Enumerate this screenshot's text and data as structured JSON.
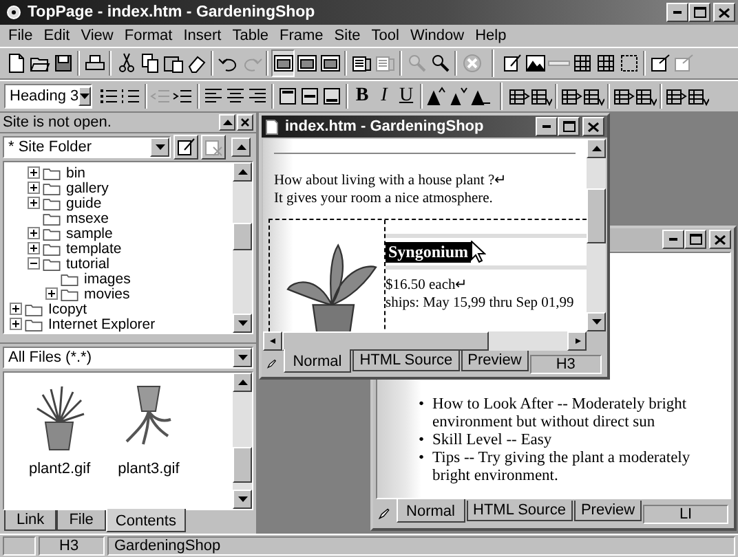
{
  "window": {
    "title": "TopPage - index.htm - GardeningShop"
  },
  "menu": [
    "File",
    "Edit",
    "View",
    "Format",
    "Insert",
    "Table",
    "Frame",
    "Site",
    "Tool",
    "Window",
    "Help"
  ],
  "toolbar_1": [
    {
      "disabled": false,
      "pressed": false
    },
    {
      "disabled": false,
      "pressed": false
    },
    {
      "disabled": false,
      "pressed": false
    },
    {
      "disabled": false,
      "pressed": false
    },
    {
      "disabled": false,
      "pressed": false
    },
    {
      "disabled": false,
      "pressed": false
    },
    {
      "disabled": false,
      "pressed": false
    },
    {
      "disabled": false,
      "pressed": false
    },
    {
      "disabled": false,
      "pressed": false
    },
    {
      "disabled": true,
      "pressed": false
    },
    {
      "disabled": false,
      "pressed": true
    },
    {
      "disabled": false,
      "pressed": false
    },
    {
      "disabled": false,
      "pressed": false
    },
    {
      "disabled": false,
      "pressed": false
    },
    {
      "disabled": true,
      "pressed": false
    },
    {
      "disabled": true,
      "pressed": false
    },
    {
      "disabled": false,
      "pressed": false
    },
    {
      "disabled": true,
      "pressed": false
    },
    {
      "disabled": false,
      "pressed": false
    },
    {
      "disabled": false,
      "pressed": false
    },
    {
      "disabled": true,
      "pressed": false
    },
    {
      "disabled": false,
      "pressed": false
    },
    {
      "disabled": false,
      "pressed": false
    },
    {
      "disabled": false,
      "pressed": false
    },
    {
      "disabled": false,
      "pressed": false
    },
    {
      "disabled": true,
      "pressed": false
    }
  ],
  "toolbar_2": {
    "paragraph_style": "Heading 3",
    "format_buttons": [
      "B",
      "I",
      "U"
    ],
    "buttons": [
      {
        "disabled": false
      },
      {
        "disabled": false
      },
      {
        "disabled": true
      },
      {
        "disabled": false
      },
      {
        "disabled": false
      },
      {
        "disabled": false
      },
      {
        "disabled": false
      },
      {
        "disabled": false
      },
      {
        "disabled": false
      },
      {
        "disabled": false
      },
      {
        "disabled": false
      },
      {
        "disabled": false
      },
      {
        "disabled": false
      },
      {
        "disabled": false
      },
      {
        "disabled": false
      },
      {
        "disabled": false
      },
      {
        "disabled": false
      },
      {
        "disabled": false
      },
      {
        "disabled": false
      },
      {
        "disabled": false
      },
      {
        "disabled": false
      }
    ]
  },
  "site_panel": {
    "status": "Site is not open.",
    "folder_select": "* Site Folder",
    "tree": [
      {
        "children": [
          {
            "label": "bin",
            "expanded": false
          },
          {
            "label": "gallery",
            "expanded": false
          },
          {
            "label": "guide",
            "expanded": false
          },
          {
            "label": "msexe"
          },
          {
            "label": "sample",
            "expanded": false
          },
          {
            "label": "template",
            "expanded": false
          },
          {
            "label": "tutorial",
            "expanded": true,
            "children": [
              {
                "label": "images"
              },
              {
                "label": "movies",
                "expanded": false
              }
            ]
          }
        ]
      },
      {
        "label": "Icopyt",
        "expanded": false
      },
      {
        "label": "Internet Explorer",
        "expanded": false
      }
    ],
    "filter_select": "All Files (*.*)",
    "files": [
      {
        "name": "plant2.gif",
        "kind": "potted"
      },
      {
        "name": "plant3.gif",
        "kind": "upturned"
      }
    ],
    "tabs": [
      {
        "label": "Link",
        "selected": false
      },
      {
        "label": "File",
        "selected": false
      },
      {
        "label": "Contents",
        "selected": true
      }
    ]
  },
  "editor_windows": [
    {
      "kind": "bullets",
      "active": false,
      "bullets": [
        {
          "marker": "•",
          "text": "How to Look After -- Moderately bright environment but without direct sun"
        },
        {
          "marker": "•",
          "text": "Skill Level -- Easy"
        },
        {
          "marker": "•",
          "text": "Tips -- Try giving the plant a moderately bright environment."
        }
      ],
      "view_tabs": [
        {
          "label": "Normal",
          "selected": true
        },
        {
          "label": "HTML Source",
          "selected": false
        },
        {
          "label": "Preview",
          "selected": false
        }
      ],
      "element_status": "LI"
    },
    {
      "kind": "product",
      "active": true,
      "title": "index.htm - GardeningShop",
      "intro": [
        "How about living with a house plant ?↵",
        "It gives your room a nice atmosphere."
      ],
      "product_name": "Syngonium",
      "price": "$16.50 each↵",
      "shipping": "ships: May 15,99 thru Sep 01,99",
      "view_tabs": [
        {
          "label": "Normal",
          "selected": true
        },
        {
          "label": "HTML Source",
          "selected": false
        },
        {
          "label": "Preview",
          "selected": false
        }
      ],
      "element_status": "H3"
    }
  ],
  "status_bar": {
    "tag": "H3",
    "site": "GardeningShop"
  }
}
